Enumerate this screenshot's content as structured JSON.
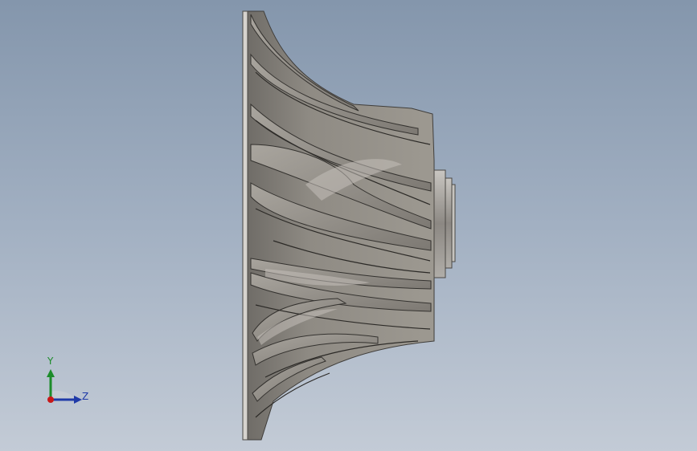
{
  "viewport": {
    "background_top": "#8496ac",
    "background_bottom": "#c3cbd6"
  },
  "model": {
    "name": "impeller-side-view",
    "color": "#8e8a84"
  },
  "triad": {
    "y_label": "Y",
    "z_label": "Z",
    "y_color": "#1c8c2a",
    "z_color": "#1f3aa8",
    "origin_color": "#c81818"
  }
}
